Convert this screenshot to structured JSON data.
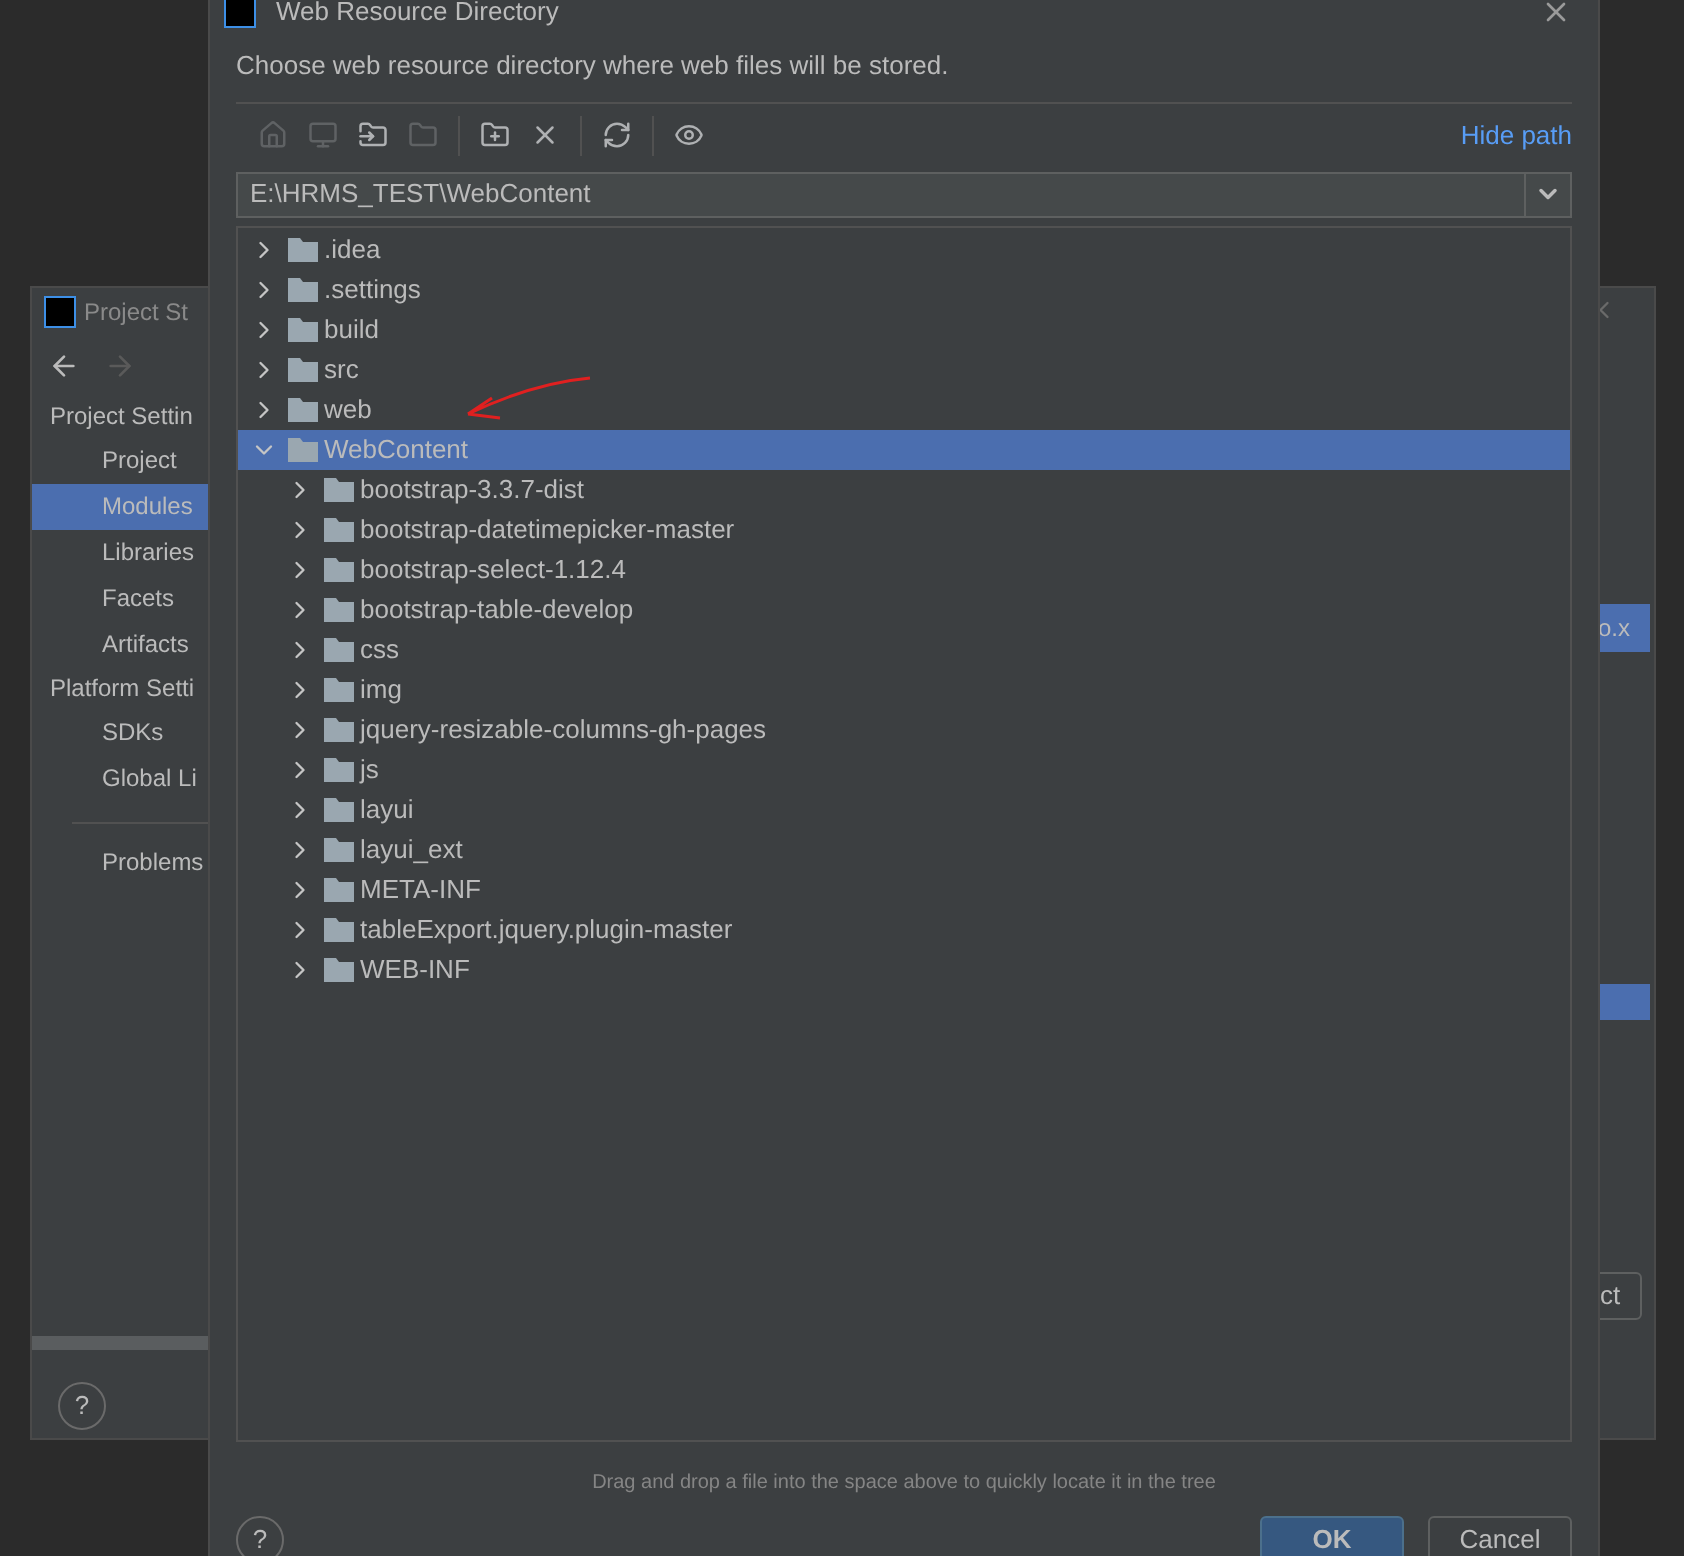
{
  "back_window": {
    "title": "Project St",
    "sidebar": {
      "sections": [
        {
          "label": "Project Settin",
          "items": [
            {
              "label": "Project",
              "selected": false
            },
            {
              "label": "Modules",
              "selected": true
            },
            {
              "label": "Libraries",
              "selected": false
            },
            {
              "label": "Facets",
              "selected": false
            },
            {
              "label": "Artifacts",
              "selected": false
            }
          ]
        },
        {
          "label": "Platform Setti",
          "items": [
            {
              "label": "SDKs",
              "selected": false
            },
            {
              "label": "Global Li",
              "selected": false
            }
          ]
        }
      ],
      "problems": "Problems"
    },
    "file_fragment": "o.x",
    "button_fragment": "ct",
    "help": "?"
  },
  "dialog": {
    "title": "Web Resource Directory",
    "description": "Choose web resource directory where web files will be stored.",
    "toolbar": [
      {
        "kind": "home",
        "disabled": true
      },
      {
        "kind": "desktop",
        "disabled": true
      },
      {
        "kind": "folder-arrow",
        "disabled": false
      },
      {
        "kind": "folder",
        "disabled": true
      },
      {
        "kind": "separator"
      },
      {
        "kind": "new-folder",
        "disabled": false
      },
      {
        "kind": "delete",
        "disabled": false
      },
      {
        "kind": "separator"
      },
      {
        "kind": "refresh",
        "disabled": false
      },
      {
        "kind": "separator"
      },
      {
        "kind": "eye",
        "disabled": false
      }
    ],
    "hide_path": "Hide path",
    "path": "E:\\HRMS_TEST\\WebContent",
    "tree": [
      {
        "label": ".idea",
        "expanded": false,
        "selected": false
      },
      {
        "label": ".settings",
        "expanded": false,
        "selected": false
      },
      {
        "label": "build",
        "expanded": false,
        "selected": false
      },
      {
        "label": "src",
        "expanded": false,
        "selected": false
      },
      {
        "label": "web",
        "expanded": false,
        "selected": false
      },
      {
        "label": "WebContent",
        "expanded": true,
        "selected": true,
        "children": [
          {
            "label": "bootstrap-3.3.7-dist",
            "expanded": false,
            "selected": false
          },
          {
            "label": "bootstrap-datetimepicker-master",
            "expanded": false,
            "selected": false
          },
          {
            "label": "bootstrap-select-1.12.4",
            "expanded": false,
            "selected": false
          },
          {
            "label": "bootstrap-table-develop",
            "expanded": false,
            "selected": false
          },
          {
            "label": "css",
            "expanded": false,
            "selected": false
          },
          {
            "label": "img",
            "expanded": false,
            "selected": false
          },
          {
            "label": "jquery-resizable-columns-gh-pages",
            "expanded": false,
            "selected": false
          },
          {
            "label": "js",
            "expanded": false,
            "selected": false
          },
          {
            "label": "layui",
            "expanded": false,
            "selected": false
          },
          {
            "label": "layui_ext",
            "expanded": false,
            "selected": false
          },
          {
            "label": "META-INF",
            "expanded": false,
            "selected": false
          },
          {
            "label": "tableExport.jquery.plugin-master",
            "expanded": false,
            "selected": false
          },
          {
            "label": "WEB-INF",
            "expanded": false,
            "selected": false
          }
        ]
      }
    ],
    "hint": "Drag and drop a file into the space above to quickly locate it in the tree",
    "help": "?",
    "buttons": [
      {
        "label": "OK",
        "default": true
      },
      {
        "label": "Cancel",
        "default": false
      }
    ]
  }
}
